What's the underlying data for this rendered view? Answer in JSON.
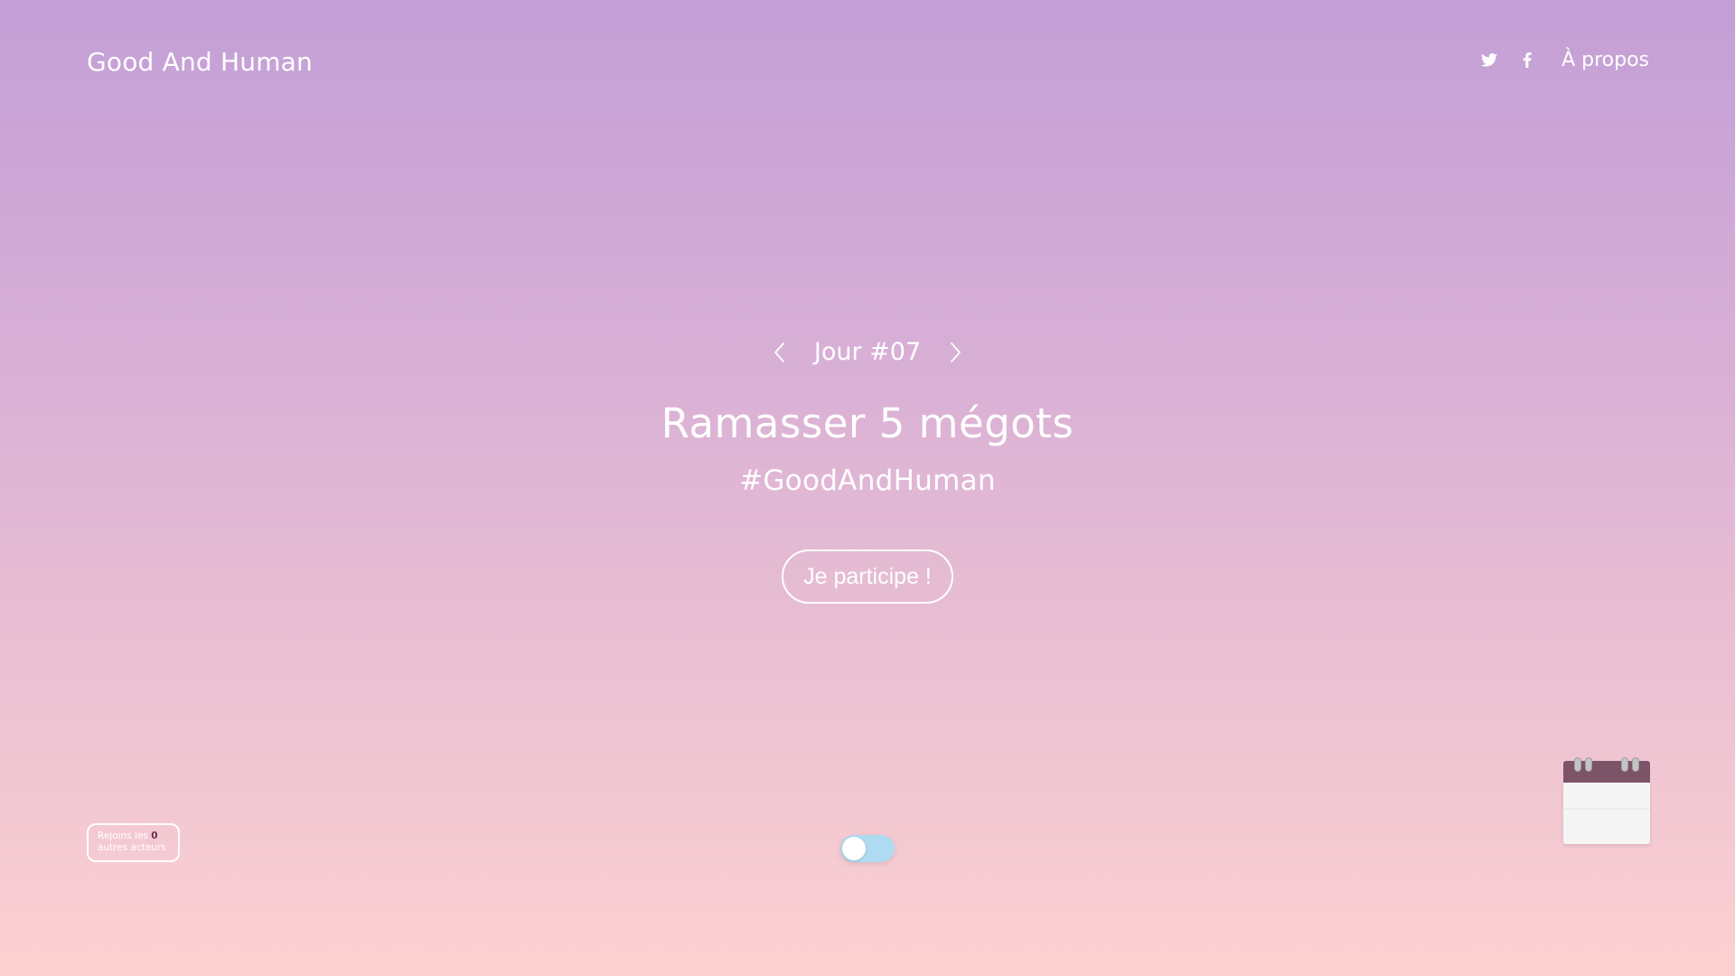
{
  "header": {
    "brand": "Good And Human",
    "nav": {
      "twitter_icon": "twitter-icon",
      "facebook_icon": "facebook-icon",
      "about_label": "À propos"
    }
  },
  "hero": {
    "day_label": "Jour #07",
    "title": "Ramasser 5 mégots",
    "hashtag": "#GoodAndHuman",
    "cta_label": "Je participe !"
  },
  "join_badge": {
    "prefix": "Rejoins les",
    "count": "0",
    "suffix": "autres acteurs"
  },
  "toggle": {
    "state": "off"
  },
  "calendar": {
    "icon": "calendar-icon"
  },
  "colors": {
    "gradient_top": "#c39fd6",
    "gradient_bottom": "#fcd1d1",
    "toggle_track": "#aedbf1",
    "calendar_header": "#7c5468",
    "text": "#ffffff"
  }
}
